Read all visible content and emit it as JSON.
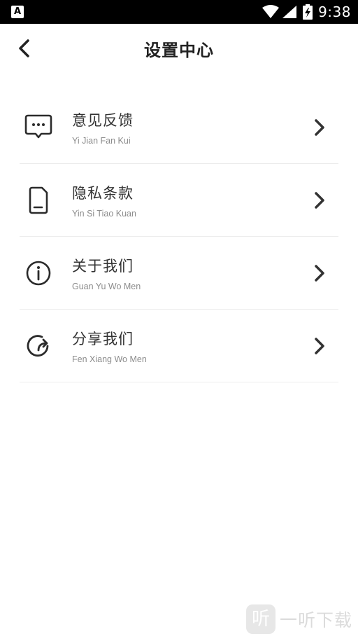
{
  "status_bar": {
    "left_icon": "A",
    "time": "9:38",
    "icons": [
      "wifi-icon",
      "signal-icon",
      "battery-charging-icon"
    ]
  },
  "header": {
    "title": "设置中心",
    "back_icon": "chevron-left-icon"
  },
  "menu": [
    {
      "title": "意见反馈",
      "subtitle": "Yi Jian Fan Kui",
      "icon": "message-dots-icon"
    },
    {
      "title": "隐私条款",
      "subtitle": "Yin Si Tiao Kuan",
      "icon": "document-icon"
    },
    {
      "title": " 关于我们",
      "subtitle": "Guan Yu Wo Men",
      "icon": "info-icon"
    },
    {
      "title": " 分享我们",
      "subtitle": "Fen Xiang Wo Men",
      "icon": "share-refresh-icon"
    }
  ],
  "watermark": {
    "logo": "听",
    "text": "一听下载"
  },
  "colors": {
    "text": "#333333",
    "subtext": "#8c8c8c",
    "divider": "#ececec",
    "status_bar": "#000000"
  }
}
